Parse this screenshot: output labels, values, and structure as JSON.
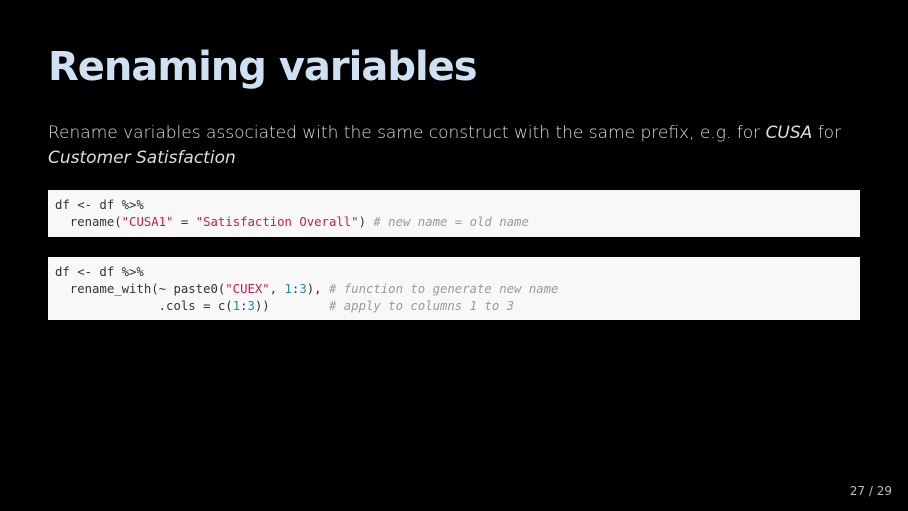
{
  "slide": {
    "title": "Renaming variables",
    "lead": {
      "part1": "Rename variables associated with the same construct with the same prefix, e.g. for ",
      "em1": "CUSA",
      "part2": " for ",
      "em2": "Customer Satisfaction"
    },
    "code_block_1": {
      "line1": "df <- df %>%",
      "line2_pre": "  rename(",
      "line2_str1": "\"CUSA1\"",
      "line2_mid": " = ",
      "line2_str2": "\"Satisfaction Overall\"",
      "line2_close": ") ",
      "line2_comment": "# new name = old name"
    },
    "code_block_2": {
      "line1": "df <- df %>%",
      "line2_pre": "  rename_with(~ paste0(",
      "line2_str": "\"CUEX\"",
      "line2_sep": ", ",
      "line2_num1": "1",
      "line2_colon": ":",
      "line2_num2": "3",
      "line2_close": "), ",
      "line2_comment": "# function to generate new name",
      "line3_pre": "              .cols = c(",
      "line3_num1": "1",
      "line3_colon": ":",
      "line3_num2": "3",
      "line3_close": "))        ",
      "line3_comment": "# apply to columns 1 to 3"
    },
    "page_number": "27 / 29"
  }
}
